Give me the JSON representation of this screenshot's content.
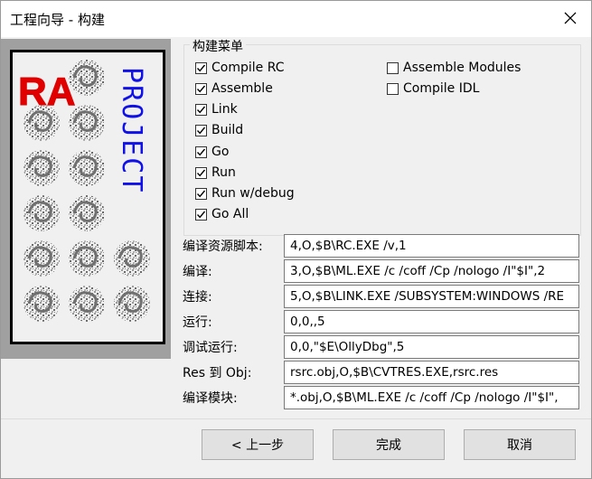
{
  "window": {
    "title": "工程向导 - 构建"
  },
  "logo": {
    "letters": "RA",
    "word": "PROJECT"
  },
  "build_menu": {
    "title": "构建菜单",
    "items": [
      {
        "label": "Compile RC",
        "checked": true
      },
      {
        "label": "Assemble",
        "checked": true
      },
      {
        "label": "Link",
        "checked": true
      },
      {
        "label": "Build",
        "checked": true
      },
      {
        "label": "Go",
        "checked": true
      },
      {
        "label": "Run",
        "checked": true
      },
      {
        "label": "Run w/debug",
        "checked": true
      },
      {
        "label": "Go All",
        "checked": true
      },
      {
        "label": "Assemble Modules",
        "checked": false
      },
      {
        "label": "Compile IDL",
        "checked": false
      }
    ]
  },
  "fields": [
    {
      "label": "编译资源脚本:",
      "value": "4,O,$B\\RC.EXE /v,1"
    },
    {
      "label": "编译:",
      "value": "3,O,$B\\ML.EXE /c /coff /Cp /nologo /I\"$I\",2"
    },
    {
      "label": "连接:",
      "value": "5,O,$B\\LINK.EXE /SUBSYSTEM:WINDOWS /RE"
    },
    {
      "label": "运行:",
      "value": "0,0,,5"
    },
    {
      "label": "调试运行:",
      "value": "0,0,\"$E\\OllyDbg\",5"
    },
    {
      "label": "Res 到 Obj:",
      "value": "rsrc.obj,O,$B\\CVTRES.EXE,rsrc.res"
    },
    {
      "label": "编译模块:",
      "value": "*.obj,O,$B\\ML.EXE /c /coff /Cp /nologo /I\"$I\","
    }
  ],
  "buttons": {
    "back": "< 上一步",
    "finish": "完成",
    "cancel": "取消"
  },
  "colors": {
    "logo_red": "#e00000",
    "logo_blue": "#1010e8",
    "check": "#000000"
  }
}
